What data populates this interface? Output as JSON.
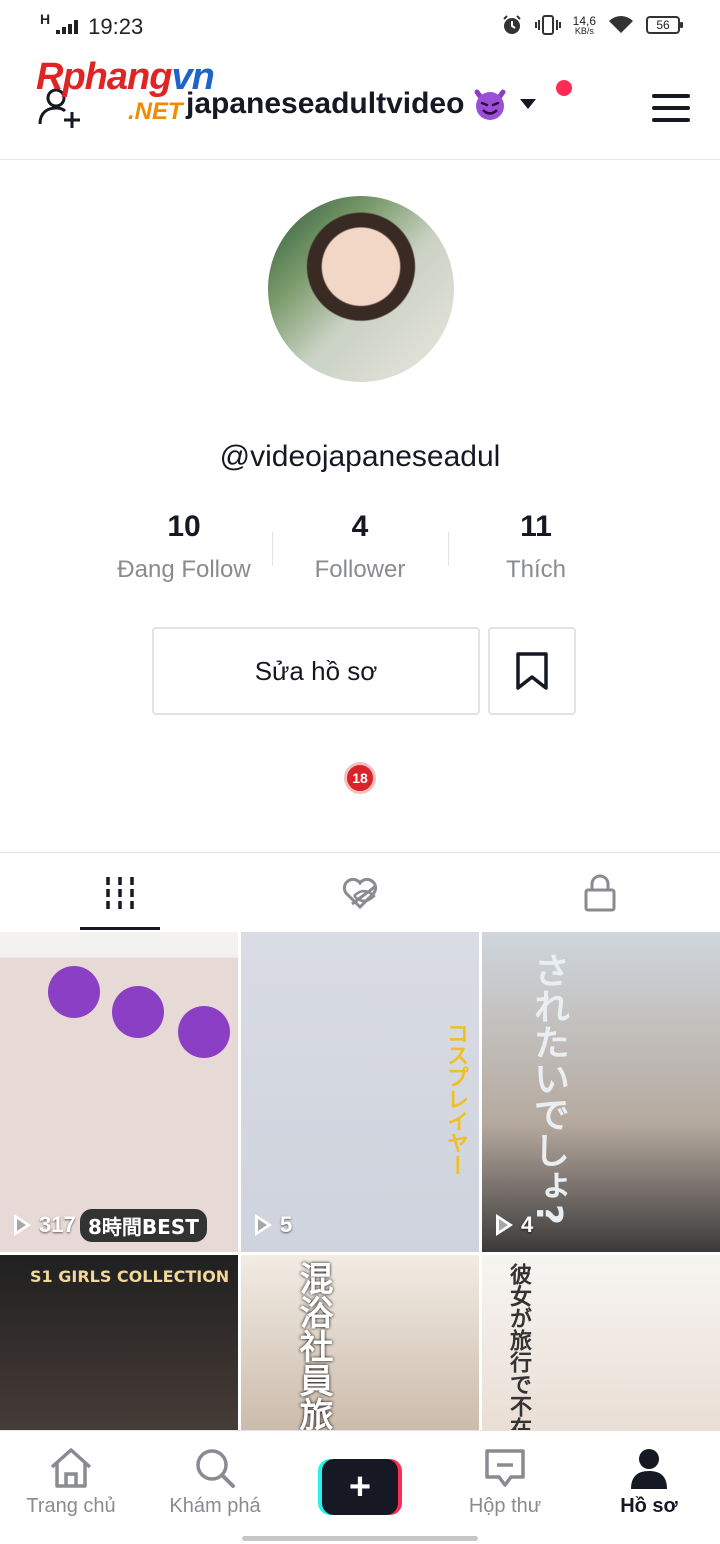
{
  "status_bar": {
    "network": "H",
    "time": "19:23",
    "speed_value": "14,6",
    "speed_unit": "KB/s",
    "battery": "56"
  },
  "header": {
    "watermark_top_a": "Rphang",
    "watermark_top_b": "vn",
    "watermark_bottom": ".NET",
    "username": "japaneseadultvideo",
    "username_emoji": "devil-emoji"
  },
  "profile": {
    "handle": "@videojapaneseadul",
    "stats": [
      {
        "value": "10",
        "label": "Đang Follow"
      },
      {
        "value": "4",
        "label": "Follower"
      },
      {
        "value": "11",
        "label": "Thích"
      }
    ],
    "edit_label": "Sửa hồ sơ",
    "age_badge": "18"
  },
  "tabs": [
    {
      "icon": "videos-grid-icon",
      "active": true
    },
    {
      "icon": "liked-hidden-icon",
      "active": false
    },
    {
      "icon": "lock-icon",
      "active": false
    }
  ],
  "videos": [
    {
      "views": "317",
      "caption": "8時間BEST"
    },
    {
      "views": "5",
      "caption": "コスプレイヤー"
    },
    {
      "views": "4",
      "caption": "されたいでしょ?"
    },
    {
      "views": "",
      "caption": "S1 GIRLS COLLECTION"
    },
    {
      "views": "",
      "caption": "混浴社員旅行"
    },
    {
      "views": "",
      "caption": "彼女が旅行で不在の間"
    }
  ],
  "bottom_nav": [
    {
      "label": "Trang chủ",
      "icon": "home-icon"
    },
    {
      "label": "Khám phá",
      "icon": "search-icon"
    },
    {
      "label": "",
      "icon": "plus-icon"
    },
    {
      "label": "Hộp thư",
      "icon": "inbox-icon"
    },
    {
      "label": "Hồ sơ",
      "icon": "profile-icon"
    }
  ],
  "colors": {
    "accent_red": "#fe2c55",
    "accent_cyan": "#25f4ee",
    "text_primary": "#161823",
    "text_secondary": "#8a8b91"
  }
}
